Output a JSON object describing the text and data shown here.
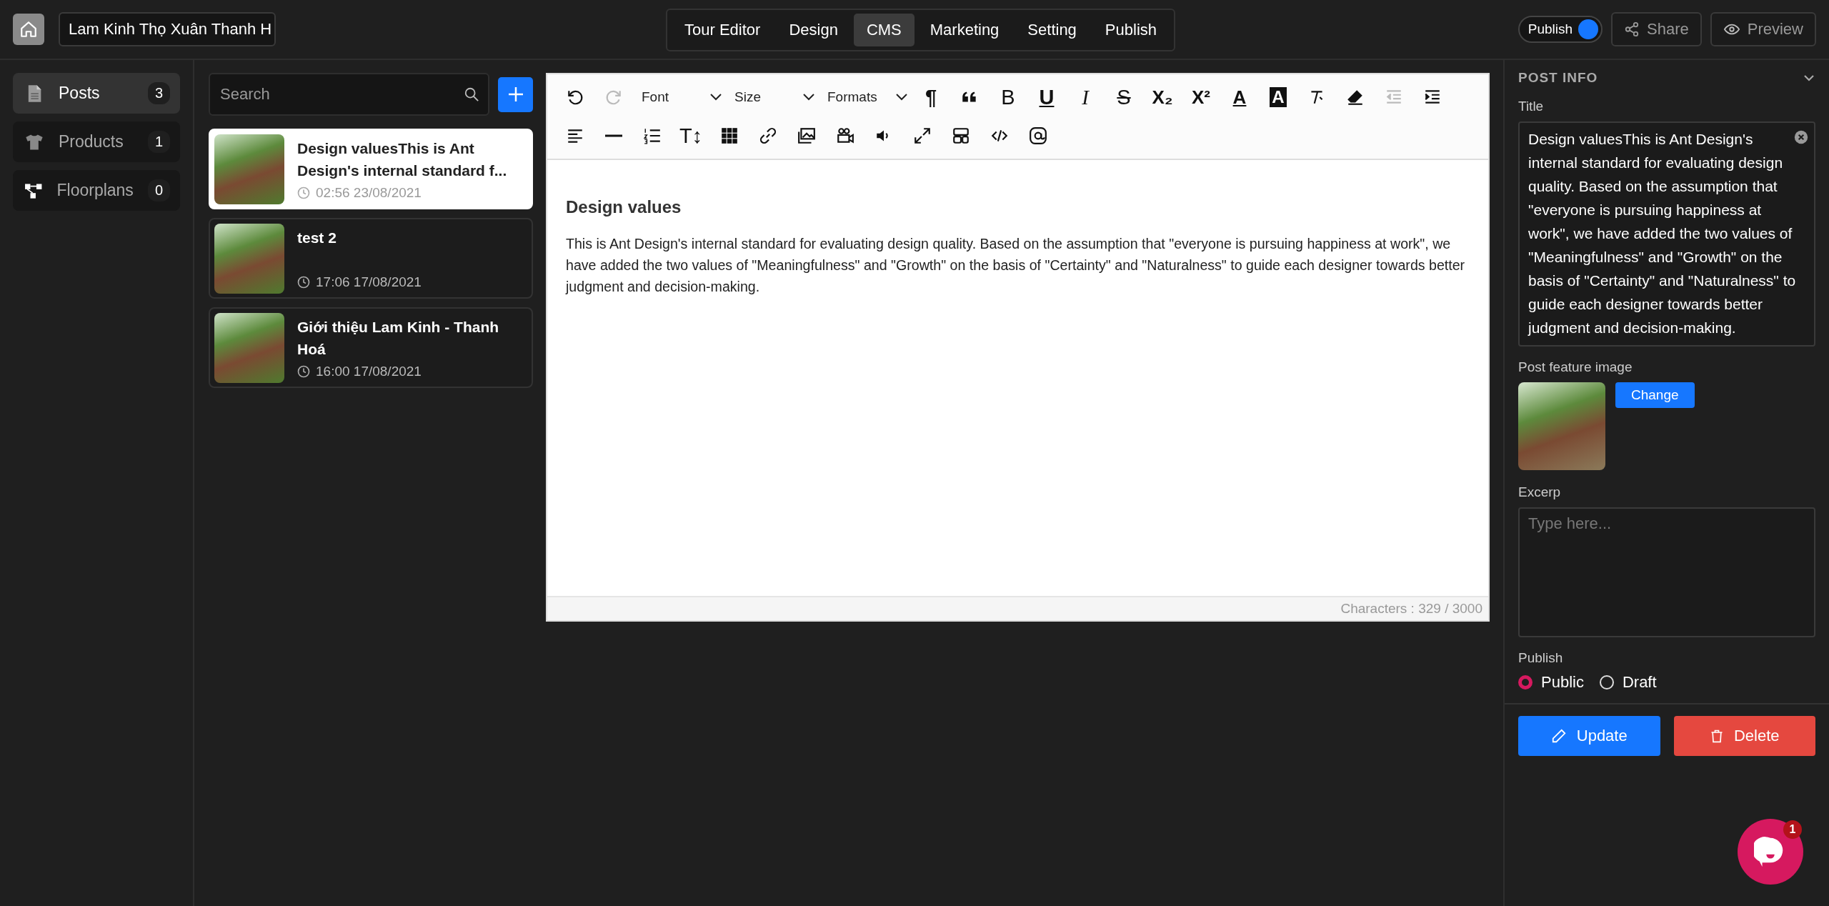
{
  "header": {
    "project_name": "Lam Kinh Thọ Xuân Thanh H",
    "tabs": [
      {
        "label": "Tour Editor",
        "selected": false
      },
      {
        "label": "Design",
        "selected": false
      },
      {
        "label": "CMS",
        "selected": true
      },
      {
        "label": "Marketing",
        "selected": false
      },
      {
        "label": "Setting",
        "selected": false
      },
      {
        "label": "Publish",
        "selected": false
      }
    ],
    "publish_toggle": {
      "label": "Publish",
      "on": true
    },
    "share": "Share",
    "preview": "Preview"
  },
  "sidebar": {
    "items": [
      {
        "label": "Posts",
        "count": "3",
        "selected": true
      },
      {
        "label": "Products",
        "count": "1",
        "selected": false
      },
      {
        "label": "Floorplans",
        "count": "0",
        "selected": false
      }
    ]
  },
  "post_list": {
    "search": {
      "placeholder": "Search"
    },
    "posts": [
      {
        "title": "Design valuesThis is Ant Design's internal standard f...",
        "time": "02:56 23/08/2021",
        "selected": true
      },
      {
        "title": "test 2",
        "time": "17:06 17/08/2021",
        "selected": false
      },
      {
        "title": "Giới thiệu Lam Kinh - Thanh Hoá",
        "time": "16:00 17/08/2021",
        "selected": false
      }
    ]
  },
  "editor": {
    "toolbar": [
      [
        {
          "kind": "undo",
          "disabled": false
        },
        {
          "kind": "redo",
          "disabled": true
        },
        {
          "kind": "select",
          "label": "Font"
        },
        {
          "kind": "select",
          "label": "Size"
        },
        {
          "kind": "select",
          "label": "Formats"
        },
        {
          "kind": "paragraph",
          "text": "¶"
        },
        {
          "kind": "quote",
          "disabled": false
        },
        {
          "kind": "bold",
          "text": "B"
        },
        {
          "kind": "underline",
          "text": "U"
        },
        {
          "kind": "italic",
          "text": "I"
        },
        {
          "kind": "strike",
          "text": "S"
        },
        {
          "kind": "subscript",
          "text": "X₂"
        },
        {
          "kind": "superscript",
          "text": "X²"
        },
        {
          "kind": "font-color",
          "text": "A"
        },
        {
          "kind": "highlight",
          "text": "A"
        },
        {
          "kind": "clear-format",
          "disabled": false
        },
        {
          "kind": "eraser",
          "disabled": false
        },
        {
          "kind": "outdent",
          "disabled": true
        },
        {
          "kind": "indent",
          "disabled": false
        }
      ],
      [
        {
          "kind": "align-left",
          "disabled": false
        },
        {
          "kind": "horizontal-rule",
          "disabled": false
        },
        {
          "kind": "ordered-list",
          "disabled": false
        },
        {
          "kind": "line-height",
          "text": "T↕"
        },
        {
          "kind": "table",
          "disabled": false
        },
        {
          "kind": "link",
          "disabled": false
        },
        {
          "kind": "image",
          "disabled": false
        },
        {
          "kind": "video",
          "disabled": false
        },
        {
          "kind": "audio",
          "disabled": false
        },
        {
          "kind": "fullscreen",
          "disabled": false
        },
        {
          "kind": "template",
          "disabled": false
        },
        {
          "kind": "code",
          "disabled": false
        },
        {
          "kind": "mention",
          "disabled": false
        }
      ]
    ],
    "heading": "Design values",
    "paragraph": "This is Ant Design's internal standard for evaluating design quality. Based on the assumption that \"everyone is pursuing happiness at work\", we have added the two values of \"Meaningfulness\" and \"Growth\" on the basis of \"Certainty\" and \"Naturalness\" to guide each designer towards better judgment and decision-making.",
    "counter": "Characters : 329 / 3000"
  },
  "post_info": {
    "heading": "POST INFO",
    "expanded": true,
    "title_label": "Title",
    "title_value": "Design valuesThis is Ant Design's internal standard for evaluating design quality. Based on the assumption that \"everyone is pursuing happiness at work\", we have added the two values of \"Meaningfulness\" and \"Growth\" on the basis of \"Certainty\" and \"Naturalness\" to guide each designer towards better judgment and decision-making.",
    "image_label": "Post feature image",
    "change_button": "Change",
    "excerpt_label": "Excerp",
    "excerpt": {
      "placeholder": "Type here..."
    },
    "publish_label": "Publish",
    "publish_options": [
      {
        "label": "Public",
        "selected": true
      },
      {
        "label": "Draft",
        "selected": false
      }
    ],
    "update_button": "Update",
    "delete_button": "Delete"
  },
  "chat": {
    "badge": "1"
  }
}
